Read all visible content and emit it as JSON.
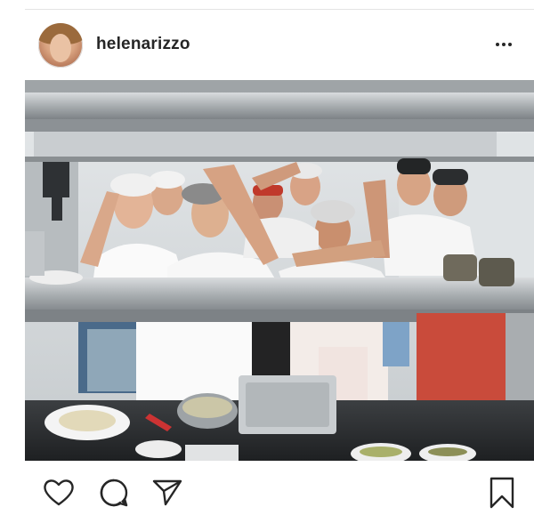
{
  "post": {
    "username": "helenarizzo",
    "more_icon": "more-options-icon"
  },
  "photo": {
    "description_icon": "kitchen-crew-photo"
  },
  "actions": {
    "like_icon": "heart-icon",
    "comment_icon": "comment-icon",
    "share_icon": "send-icon",
    "save_icon": "bookmark-icon"
  },
  "colors": {
    "text": "#262626",
    "divider": "#e3e3e3"
  }
}
